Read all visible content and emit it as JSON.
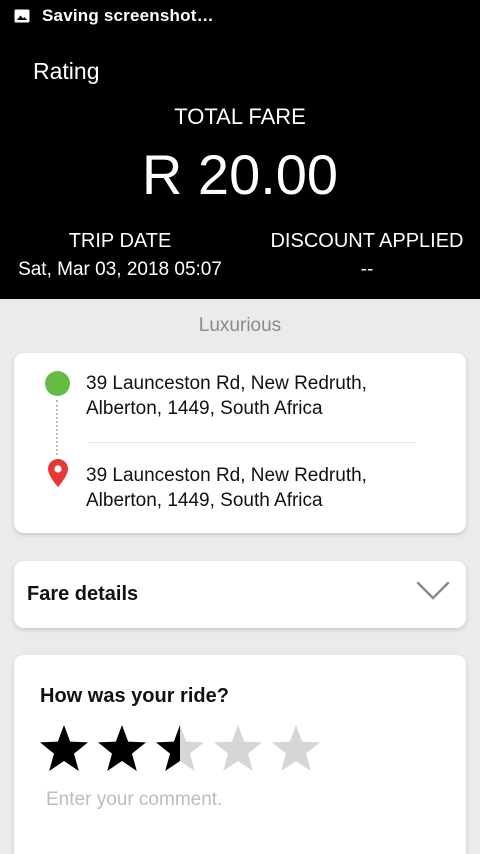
{
  "status_bar": {
    "text": "Saving screenshot…"
  },
  "header": {
    "title": "Rating",
    "total_fare_label": "TOTAL FARE",
    "total_fare_value": "R 20.00",
    "trip_date_label": "TRIP DATE",
    "trip_date_value": "Sat, Mar 03, 2018 05:07",
    "discount_label": "DISCOUNT APPLIED",
    "discount_value": "--"
  },
  "car_type": "Luxurious",
  "route": {
    "pickup_line1": "39 Launceston Rd, New Redruth,",
    "pickup_line2": "Alberton, 1449, South Africa",
    "dropoff_line1": "39 Launceston Rd, New Redruth,",
    "dropoff_line2": "Alberton, 1449, South Africa"
  },
  "fare_details": {
    "label": "Fare details"
  },
  "rating": {
    "question": "How was your ride?",
    "value": 2.5,
    "max": 5,
    "comment_placeholder": "Enter your comment."
  },
  "colors": {
    "header_bg": "#000000",
    "pickup_dot": "#66bb44",
    "dropoff_pin": "#e53935",
    "star_filled": "#000000",
    "star_empty": "#d6d6d6"
  },
  "icons": {
    "status": "image-icon",
    "pickup": "pickup-dot-icon",
    "dropoff": "location-pin-icon",
    "expand": "chevron-down-icon",
    "star": "star-icon"
  }
}
